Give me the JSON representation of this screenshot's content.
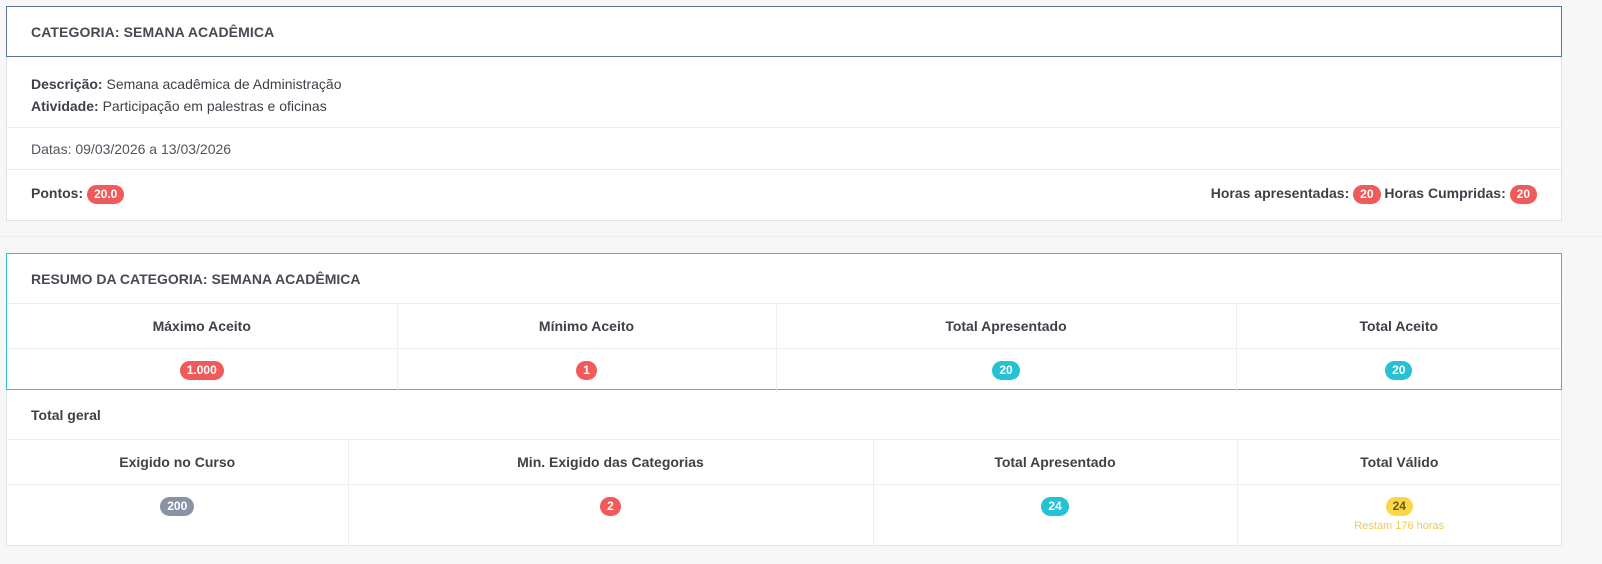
{
  "categoria": {
    "header": "CATEGORIA: SEMANA ACADÊMICA",
    "descricao_label": "Descrição:",
    "descricao_value": "Semana acadêmica de Administração",
    "atividade_label": "Atividade:",
    "atividade_value": "Participação em palestras e oficinas",
    "datas": "Datas: 09/03/2026 a 13/03/2026",
    "pontos_label": "Pontos:",
    "pontos_value": "20.0",
    "horas_apresentadas_label": "Horas apresentadas:",
    "horas_apresentadas_value": "20",
    "horas_cumpridas_label": "Horas Cumpridas:",
    "horas_cumpridas_value": "20"
  },
  "resumo": {
    "header": "RESUMO DA CATEGORIA: SEMANA ACADÊMICA",
    "columns": [
      "Máximo Aceito",
      "Mínimo Aceito",
      "Total Apresentado",
      "Total Aceito"
    ],
    "values": [
      "1.000",
      "1",
      "20",
      "20"
    ]
  },
  "total_geral": {
    "title": "Total geral",
    "columns": [
      "Exigido no Curso",
      "Min. Exigido das Categorias",
      "Total Apresentado",
      "Total Válido"
    ],
    "values": [
      "200",
      "2",
      "24",
      "24"
    ],
    "restam": "Restam 176 horas"
  },
  "colors": {
    "badge_red": "#f05a5a",
    "badge_cyan": "#26c2d3",
    "badge_gray": "#8a93a3",
    "badge_yellow": "#f8d84a",
    "resumo_border": "#30c2cf",
    "categoria_border": "#5c7396"
  }
}
